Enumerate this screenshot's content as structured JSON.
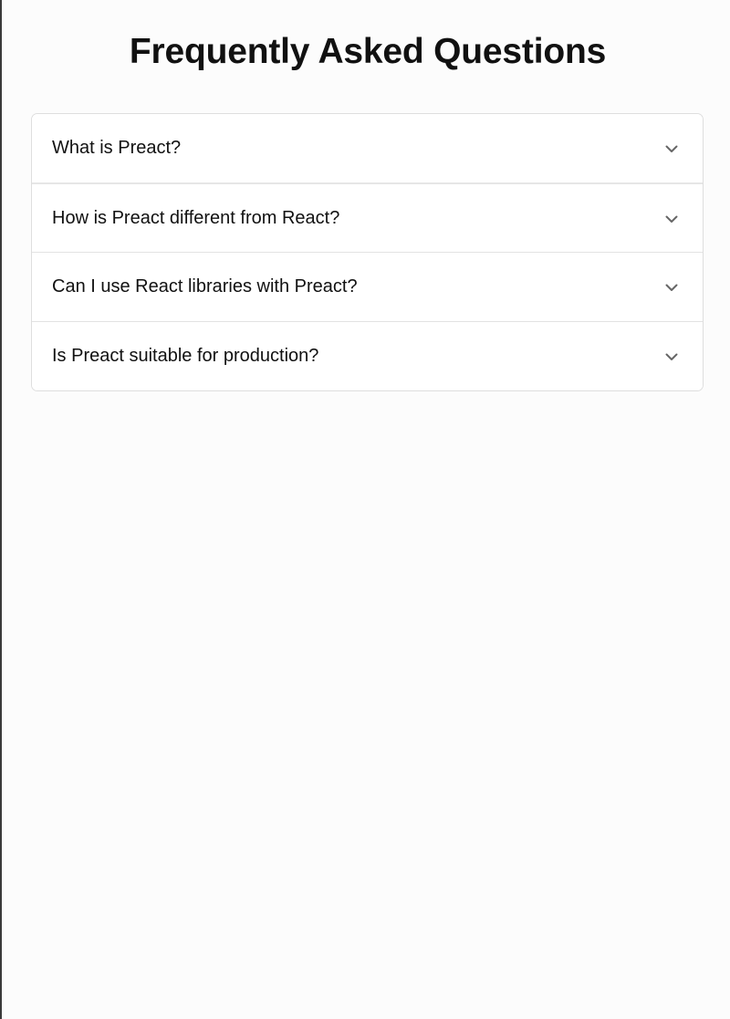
{
  "page": {
    "title": "Frequently Asked Questions"
  },
  "faq": {
    "items": [
      {
        "question": "What is Preact?",
        "expanded": false,
        "icon": "chevron-down-icon"
      },
      {
        "question": "How is Preact different from React?",
        "expanded": false,
        "icon": "chevron-down-icon"
      },
      {
        "question": "Can I use React libraries with Preact?",
        "expanded": false,
        "icon": "chevron-down-icon"
      },
      {
        "question": "Is Preact suitable for production?",
        "expanded": false,
        "icon": "chevron-down-icon"
      }
    ]
  },
  "colors": {
    "background": "#fcfcfc",
    "card": "#ffffff",
    "border": "#dedede",
    "text": "#111111",
    "icon": "#666666"
  }
}
